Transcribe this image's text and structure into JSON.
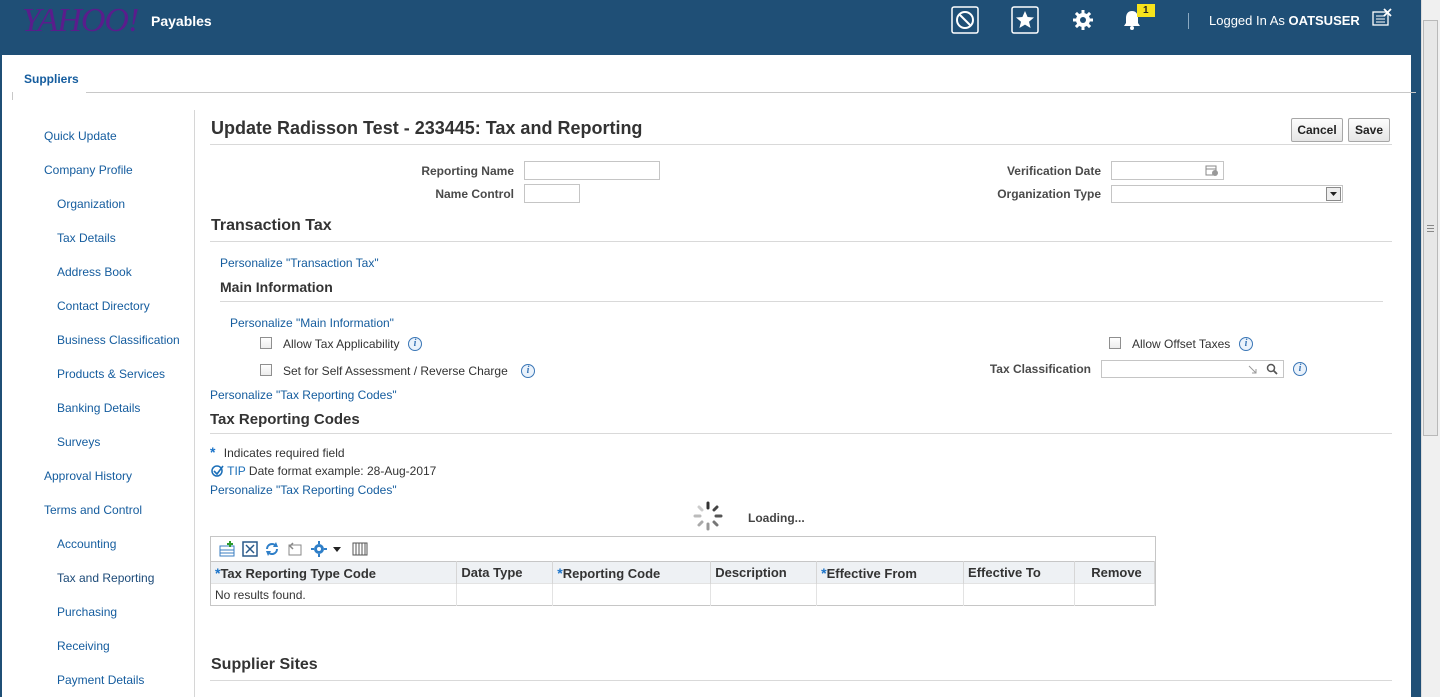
{
  "header": {
    "brand": "YAHOO!",
    "app_name": "Payables",
    "notification_count": "1",
    "logged_in_prefix": "Logged In As",
    "username": "OATSUSER",
    "icons": [
      "watchlist-icon",
      "favorites-icon",
      "settings-icon",
      "notifications-icon",
      "close-window-icon"
    ]
  },
  "tabs": {
    "active": "Suppliers"
  },
  "sidebar": {
    "items": [
      {
        "label": "Quick Update",
        "level": 0
      },
      {
        "label": "Company Profile",
        "level": 0
      },
      {
        "label": "Organization",
        "level": 1
      },
      {
        "label": "Tax Details",
        "level": 1
      },
      {
        "label": "Address Book",
        "level": 1
      },
      {
        "label": "Contact Directory",
        "level": 1
      },
      {
        "label": "Business Classification",
        "level": 1
      },
      {
        "label": "Products & Services",
        "level": 1
      },
      {
        "label": "Banking Details",
        "level": 1
      },
      {
        "label": "Surveys",
        "level": 1
      },
      {
        "label": "Approval History",
        "level": 0
      },
      {
        "label": "Terms and Control",
        "level": 0
      },
      {
        "label": "Accounting",
        "level": 1
      },
      {
        "label": "Tax and Reporting",
        "level": 1,
        "selected": true
      },
      {
        "label": "Purchasing",
        "level": 1
      },
      {
        "label": "Receiving",
        "level": 1
      },
      {
        "label": "Payment Details",
        "level": 1
      }
    ]
  },
  "main": {
    "title": "Update Radisson Test - 233445: Tax and Reporting",
    "cancel_label": "Cancel",
    "save_label": "Save",
    "fields": {
      "reporting_name_label": "Reporting Name",
      "reporting_name_value": "",
      "name_control_label": "Name Control",
      "name_control_value": "",
      "verification_date_label": "Verification Date",
      "verification_date_value": "",
      "organization_type_label": "Organization Type",
      "organization_type_value": ""
    },
    "transaction_tax": {
      "heading": "Transaction Tax",
      "personalize_link": "Personalize \"Transaction Tax\"",
      "main_info_heading": "Main Information",
      "personalize_main_info": "Personalize \"Main Information\"",
      "allow_tax_applicability": "Allow Tax Applicability",
      "self_assessment": "Set for Self Assessment / Reverse Charge",
      "allow_offset_taxes": "Allow Offset Taxes",
      "tax_classification_label": "Tax Classification",
      "tax_classification_value": ""
    },
    "tax_reporting_codes": {
      "personalize_link_1": "Personalize \"Tax Reporting Codes\"",
      "heading": "Tax Reporting Codes",
      "required_note": "Indicates required field",
      "tip_label": "TIP",
      "tip_text": "Date format example: 28-Aug-2017",
      "personalize_link_2": "Personalize \"Tax Reporting Codes\"",
      "loading_text": "Loading...",
      "columns": [
        {
          "label": "Tax Reporting Type Code",
          "required": true
        },
        {
          "label": "Data Type",
          "required": false
        },
        {
          "label": "Reporting Code",
          "required": true
        },
        {
          "label": "Description",
          "required": false
        },
        {
          "label": "Effective From",
          "required": true
        },
        {
          "label": "Effective To",
          "required": false
        },
        {
          "label": "Remove",
          "required": false
        }
      ],
      "empty_text": "No results found."
    },
    "supplier_sites_heading": "Supplier Sites"
  },
  "colors": {
    "header_bg": "#1f4f76",
    "link": "#145c9e",
    "required_marker": "#1a73c9",
    "badge": "#f7e31b"
  }
}
